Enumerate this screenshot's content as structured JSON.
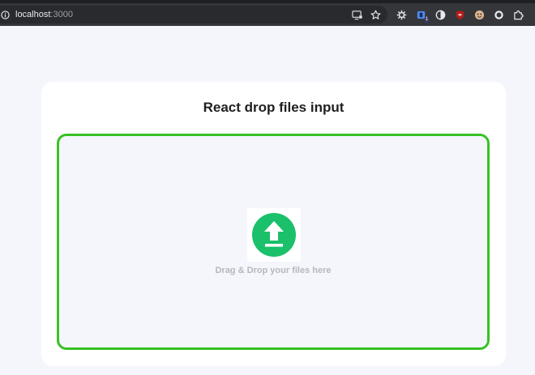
{
  "browser": {
    "url_host": "localhost",
    "url_port": ":3000",
    "icons": {
      "site_info": "info-circle-icon",
      "install_app": "install-app-icon",
      "bookmark": "star-icon"
    },
    "extensions": [
      {
        "icon": "gear-extension-icon"
      },
      {
        "icon": "extension-blue-icon",
        "badge": "1"
      },
      {
        "icon": "extension-circle-icon"
      },
      {
        "icon": "ublock-icon"
      },
      {
        "icon": "avatar-extension-icon"
      },
      {
        "icon": "extension-dark-circle-icon"
      },
      {
        "icon": "puzzle-piece-icon"
      }
    ]
  },
  "page": {
    "title": "React drop files input",
    "drop_text": "Drag & Drop your files here",
    "colors": {
      "accent": "#37c223",
      "upload_icon": "#1bc06b",
      "background": "#f4f6fc"
    }
  }
}
